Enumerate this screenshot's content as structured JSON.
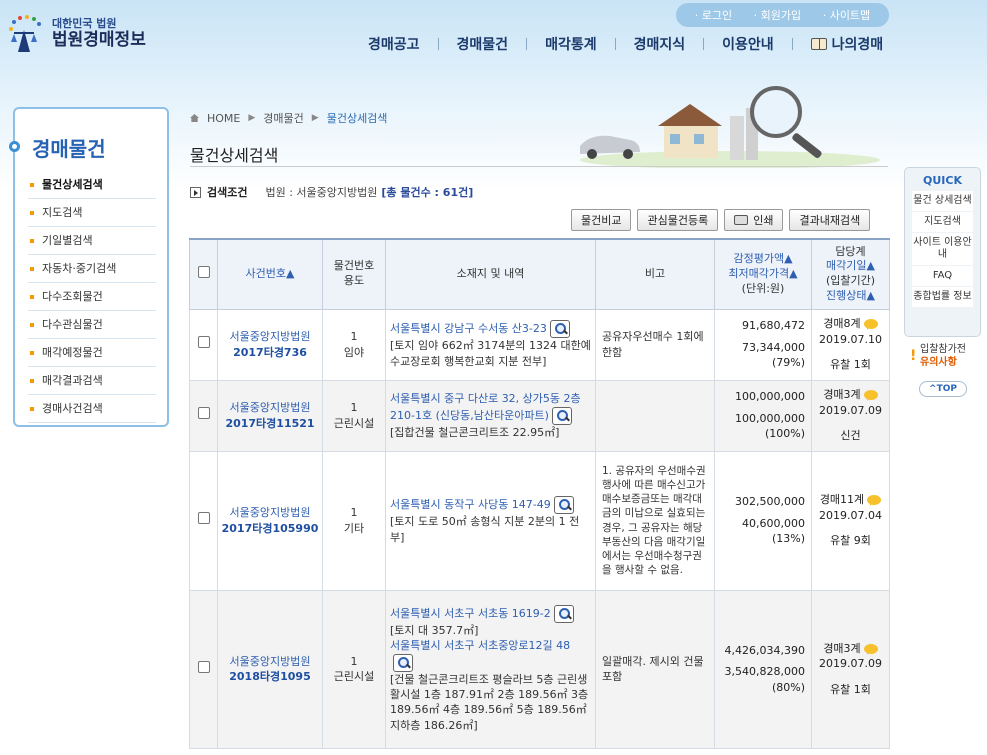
{
  "header": {
    "logo_line1": "대한민국 법원",
    "logo_line2": "법원경매정보",
    "util": [
      "· 로그인",
      "· 회원가입",
      "· 사이트맵"
    ],
    "gnb": [
      "경매공고",
      "경매물건",
      "매각통계",
      "경매지식",
      "이용안내",
      "나의경매"
    ]
  },
  "sidebar": {
    "title": "경매물건",
    "items": [
      "물건상세검색",
      "지도검색",
      "기일별검색",
      "자동차·중기검색",
      "다수조회물건",
      "다수관심물건",
      "매각예정물건",
      "매각결과검색",
      "경매사건검색"
    ]
  },
  "breadcrumb": [
    "HOME",
    "경매물건",
    "물건상세검색"
  ],
  "page_title": "물건상세검색",
  "condition": {
    "label": "검색조건",
    "value": "법원 : 서울중앙지방법원",
    "count": "[총 물건수 : 61건]"
  },
  "buttons": {
    "compare": "물건비교",
    "watch": "관심물건등록",
    "print": "인쇄",
    "result": "결과내재검색"
  },
  "table": {
    "headers": {
      "case": "사건번호▲",
      "itemno": "물건번호",
      "usage": "용도",
      "addr": "소재지 및 내역",
      "note": "비고",
      "price1": "감정평가액▲",
      "price2": "최저매각가격▲",
      "unit": "(단위:원)",
      "h1": "담당계",
      "h2": "매각기일▲",
      "h3": "(입찰기간)",
      "h4": "진행상태▲"
    },
    "rows": [
      {
        "court": "서울중앙지방법원",
        "case": "2017타경736",
        "num": "1",
        "usage": "임야",
        "addr1": "서울특별시 강남구 수서동 산3-23",
        "detail1": "[토지 임야 662㎡ 3174분의 1324 대한예수교장로회 행복한교회 지분 전부]",
        "note": "공유자우선매수 1회에 한함",
        "appraisal": "91,680,472",
        "minprice": "73,344,000",
        "pct": "(79%)",
        "dept": "경매8계",
        "date": "2019.07.10",
        "status": "유찰 1회"
      },
      {
        "court": "서울중앙지방법원",
        "case": "2017타경11521",
        "num": "1",
        "usage": "근린시설",
        "addr1": "서울특별시 중구 다산로 32, 상가5동 2층210-1호 (신당동,남산타운아파트)",
        "detail1": "[집합건물 철근콘크리트조 22.95㎡]",
        "note": "",
        "appraisal": "100,000,000",
        "minprice": "100,000,000",
        "pct": "(100%)",
        "dept": "경매3계",
        "date": "2019.07.09",
        "status": "신건"
      },
      {
        "court": "서울중앙지방법원",
        "case": "2017타경105990",
        "num": "1",
        "usage": "기타",
        "addr1": "서울특별시 동작구 사당동 147-49",
        "detail1": "[토지 도로 50㎡ 송형식 지분 2분의 1 전부]",
        "note": "1. 공유자의 우선매수권 행사에 따른 매수신고가 매수보증금또는 매각대금의 미납으로 실효되는 경우, 그 공유자는 해당 부동산의 다음 매각기일에서는 우선매수청구권을 행사할 수 없음.",
        "appraisal": "302,500,000",
        "minprice": "40,600,000",
        "pct": "(13%)",
        "dept": "경매11계",
        "date": "2019.07.04",
        "status": "유찰 9회"
      },
      {
        "court": "서울중앙지방법원",
        "case": "2018타경1095",
        "num": "1",
        "usage": "근린시설",
        "addr1": "서울특별시 서초구 서초동 1619-2",
        "detail1": "[토지 대 357.7㎡]",
        "addr2": "서울특별시 서초구 서초중앙로12길 48",
        "detail2": "[건물 철근콘크리트조 평슬라브 5층 근린생활시설 1층 187.91㎡ 2층 189.56㎡ 3층 189.56㎡ 4층 189.56㎡ 5층 189.56㎡ 지하층 186.26㎡]",
        "note": "일괄매각. 제시외 건물 포함",
        "appraisal": "4,426,034,390",
        "minprice": "3,540,828,000",
        "pct": "(80%)",
        "dept": "경매3계",
        "date": "2019.07.09",
        "status": "유찰 1회"
      }
    ]
  },
  "quick": {
    "title": "QUICK",
    "items": [
      "물건 상세검색",
      "지도검색",
      "사이트 이용안내",
      "FAQ",
      "종합법률 정보"
    ],
    "notice1": "입찰참가전",
    "notice2": "유의사항",
    "top": "TOP"
  }
}
